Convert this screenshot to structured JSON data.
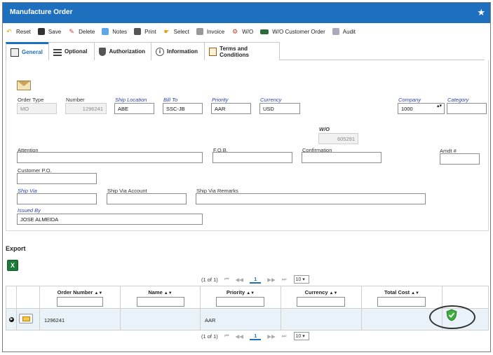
{
  "window": {
    "title": "Manufacture Order"
  },
  "toolbar": {
    "reset": "Reset",
    "save": "Save",
    "delete": "Delete",
    "notes": "Notes",
    "print": "Print",
    "select": "Select",
    "invoice": "Invoice",
    "wo": "W/O",
    "wo_customer_order": "W/O Customer Order",
    "audit": "Audit"
  },
  "tabs": {
    "general": "General",
    "optional": "Optional",
    "authorization": "Authorization",
    "information": "Information",
    "terms": "Terms and Conditions"
  },
  "form": {
    "order_type_label": "Order Type",
    "order_type": "MO",
    "number_label": "Number",
    "number": "1296241",
    "ship_location_label": "Ship Location",
    "ship_location": "ABE",
    "bill_to_label": "Bill To",
    "bill_to": "SSC-JB",
    "priority_label": "Priority",
    "priority": "AAR",
    "currency_label": "Currency",
    "currency": "USD",
    "company_label": "Company",
    "company": "1000",
    "category_label": "Category",
    "category": "",
    "wo_label": "W/O",
    "wo": "605291",
    "attention_label": "Attention",
    "attention": "",
    "fob_label": "F.O.B.",
    "fob": "",
    "confirmation_label": "Confirmation",
    "confirmation": "",
    "amdt_label": "Amdt #",
    "amdt": "",
    "customer_po_label": "Customer P.O.",
    "customer_po": "",
    "ship_via_label": "Ship Via",
    "ship_via": "",
    "ship_via_account_label": "Ship Via Account",
    "ship_via_account": "",
    "ship_via_remarks_label": "Ship Via Remarks",
    "ship_via_remarks": "",
    "issued_by_label": "Issued By",
    "issued_by": "JOSE ALMEIDA"
  },
  "export": {
    "title": "Export"
  },
  "pager": {
    "range": "(1 of 1)",
    "page": "1",
    "per_page": "10"
  },
  "grid": {
    "columns": {
      "order_number": "Order Number",
      "name": "Name",
      "priority": "Priority",
      "currency": "Currency",
      "total_cost": "Total Cost"
    },
    "rows": [
      {
        "order_number": "1296241",
        "name": "",
        "priority": "AAR",
        "currency": "",
        "total_cost": ""
      }
    ]
  },
  "icons": {
    "status": "shield-check-icon",
    "accent": "#1f6fbf"
  }
}
